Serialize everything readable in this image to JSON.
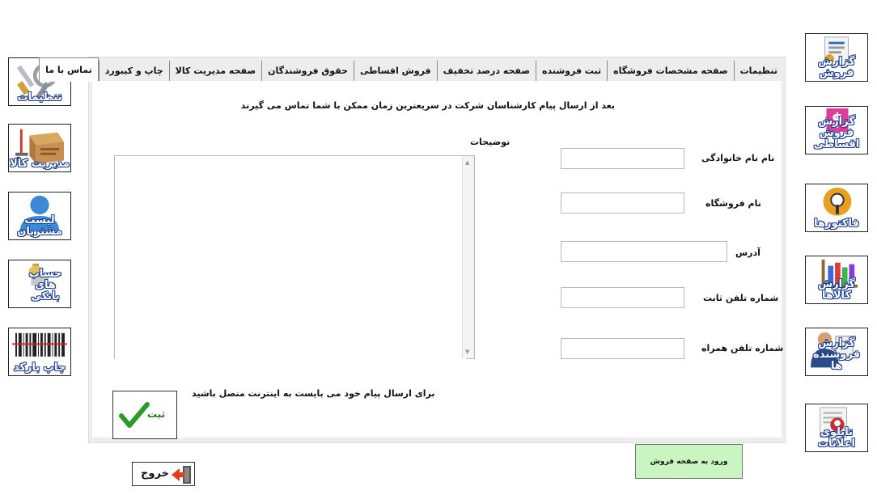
{
  "left_sidebar": {
    "settings_label": "تنظیمات",
    "product_management_label": "مدیریت کالا",
    "customer_list_label": "لیست مشتریان",
    "bank_accounts_label": "حساب های بانکی",
    "print_barcode_label": "چاپ بارکد"
  },
  "right_sidebar": {
    "sales_report_label": "گزارش فروش",
    "installment_sales_report_label": "گزارش فروش اقساطی",
    "invoices_label": "فاکتورها",
    "products_report_label": "گزارش کالاها",
    "sellers_report_label": "گزارش فروشنده ها",
    "notice_board_label": "تابلوی اعلانات"
  },
  "tabs": [
    {
      "label": "تنظیمات",
      "active": false
    },
    {
      "label": "صفحه مشخصات فروشگاه",
      "active": false
    },
    {
      "label": "ثبت فروشنده",
      "active": false
    },
    {
      "label": "صفحه درصد تخفیف",
      "active": false
    },
    {
      "label": "فروش اقساطی",
      "active": false
    },
    {
      "label": "حقوق فروشندگان",
      "active": false
    },
    {
      "label": "صفحه مدیریت کالا",
      "active": false
    },
    {
      "label": "چاپ و کیبورد",
      "active": false
    },
    {
      "label": "تماس با ما",
      "active": true
    }
  ],
  "contact": {
    "info_text": "بعد از ارسال پیام کارشناسان شرکت در سریعترین زمان ممکن با شما تماس می گیرند",
    "description_label": "توضیحات",
    "description_value": "",
    "fields": {
      "name_label": "نام نام خانوادگی",
      "store_name_label": "نام فروشگاه",
      "address_label": "آدرس",
      "landline_label": "شماره تلفن ثابت",
      "mobile_label": "شماره تلفن همراه",
      "name_value": "",
      "store_name_value": "",
      "address_value": "",
      "landline_value": "",
      "mobile_value": ""
    },
    "internet_note": "برای ارسال پیام خود می بایست به اینترنت متصل باشید",
    "submit_label": "ثبت"
  },
  "exit_label": "خروج",
  "enter_sales_page_label": "ورود به صفحه فروش",
  "colors": {
    "label_text": "#ffffff",
    "label_outline": "#1a3d8a",
    "submit_check": "#2a9a2a",
    "enter_sales_bg": "#c9f5c0",
    "exit_arrow": "#e23a1f"
  }
}
